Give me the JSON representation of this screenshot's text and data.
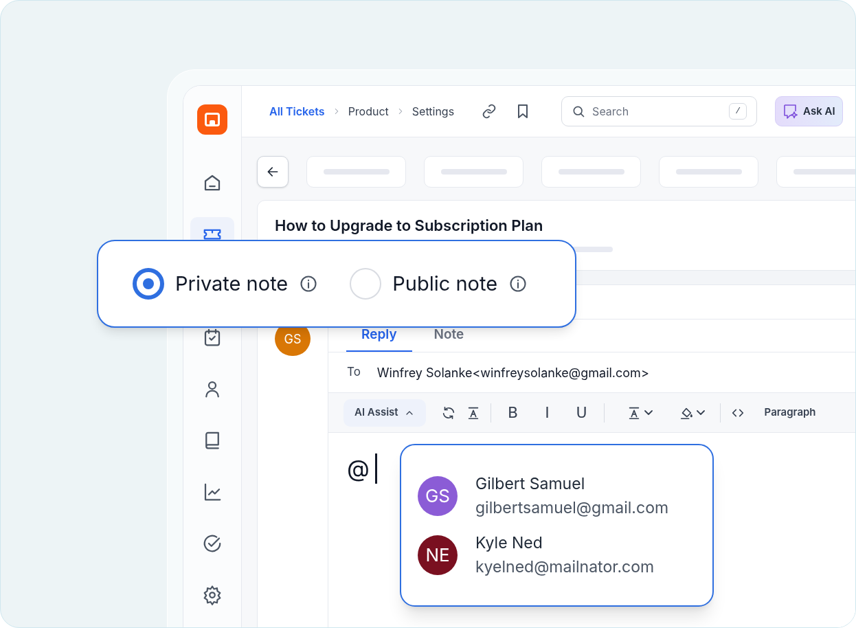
{
  "sidebar": {
    "items": [
      {
        "kind": "home",
        "selected": false
      },
      {
        "kind": "ticket",
        "selected": true
      },
      {
        "kind": "calendar",
        "selected": false
      },
      {
        "kind": "contact",
        "selected": false
      },
      {
        "kind": "book",
        "selected": false
      },
      {
        "kind": "chart",
        "selected": false
      },
      {
        "kind": "check",
        "selected": false
      },
      {
        "kind": "settings",
        "selected": false
      }
    ]
  },
  "breadcrumbs": [
    {
      "label": "All Tickets",
      "current": true
    },
    {
      "label": "Product",
      "current": false
    },
    {
      "label": "Settings",
      "current": false
    }
  ],
  "search": {
    "placeholder": "Search",
    "shortcut": "/"
  },
  "ask_ai": "Ask AI",
  "ticket": {
    "title": "How to Upgrade to Subscription Plan"
  },
  "conversation": {
    "avatar": "GS",
    "tabs": [
      {
        "label": "Reply",
        "selected": true
      },
      {
        "label": "Note",
        "selected": false
      }
    ],
    "to_label": "To",
    "recipient": "Winfrey Solanke<winfreysolanke@gmail.com>",
    "toolbar": [
      {
        "kind": "menu",
        "label": "AI Assist"
      },
      {
        "kind": "refresh"
      },
      {
        "kind": "clear-format"
      },
      {
        "kind": "divider"
      },
      {
        "kind": "glyph",
        "label": "B"
      },
      {
        "kind": "glyph",
        "label": "I"
      },
      {
        "kind": "glyph",
        "label": "U"
      },
      {
        "kind": "divider"
      },
      {
        "kind": "text-color"
      },
      {
        "kind": "highlight"
      },
      {
        "kind": "divider"
      },
      {
        "kind": "code"
      },
      {
        "kind": "text",
        "label": "Paragraph"
      }
    ],
    "body": "@"
  },
  "note_types": [
    {
      "label": "Private note",
      "selected": true
    },
    {
      "label": "Public note",
      "selected": false
    }
  ],
  "mentions": [
    {
      "initials": "GS",
      "name": "Gilbert Samuel",
      "email": "gilbertsamuel@gmail.com",
      "color": "#8b5cd6"
    },
    {
      "initials": "NE",
      "name": "Kyle Ned",
      "email": "kyelned@mailnator.com",
      "color": "#7a1020"
    }
  ]
}
